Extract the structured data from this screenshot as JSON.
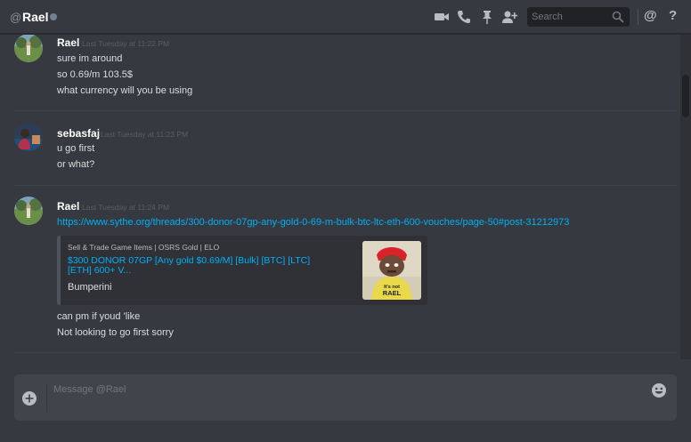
{
  "header": {
    "at_symbol": "@",
    "channel_name": "Rael",
    "status": "offline",
    "search_placeholder": "Search",
    "icons": [
      "video-icon",
      "phone-icon",
      "pin-icon",
      "add-friend-icon",
      "search-icon",
      "mention-icon",
      "help-icon"
    ],
    "mention_symbol": "@",
    "help_symbol": "?"
  },
  "messages": [
    {
      "author": "Rael",
      "timestamp": "Last Tuesday at 11:22 PM",
      "lines": [
        "sure im around",
        "so 0.69/m  103.5$",
        "what currency will you be using"
      ]
    },
    {
      "author": "sebasfaj",
      "timestamp": "Last Tuesday at 11:23 PM",
      "lines": [
        "u go first",
        "or what?"
      ]
    },
    {
      "author": "Rael",
      "timestamp": "Last Tuesday at 11:24 PM",
      "link": "https://www.sythe.org/threads/300-donor-07gp-any-gold-0-69-m-bulk-btc-ltc-eth-600-vouches/page-50#post-31212973",
      "embed": {
        "provider": "Sell & Trade Game Items | OSRS Gold | ELO",
        "title": "$300 DONOR 07GP [Any gold $0.69/M] [Bulk] [BTC] [LTC] [ETH] 600+ V...",
        "description": "Bumperini",
        "thumbnail_text": "It's not RAEL"
      },
      "lines": [
        "can pm if youd 'like",
        "Not looking to go first sorry"
      ]
    }
  ],
  "composer": {
    "placeholder": "Message @Rael"
  },
  "colors": {
    "background": "#36393f",
    "link": "#00b0f4",
    "input": "#40444b"
  }
}
